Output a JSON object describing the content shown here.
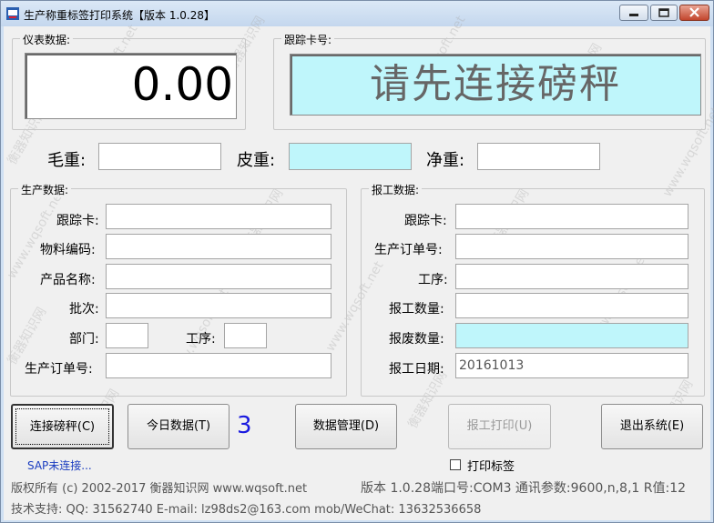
{
  "window": {
    "title": "生产称重标签打印系统【版本 1.0.28】"
  },
  "meter": {
    "group_label": "仪表数据:",
    "value": "0.00"
  },
  "card": {
    "group_label": "跟踪卡号:",
    "message": "请先连接磅秤"
  },
  "weights": {
    "gross_label": "毛重:",
    "tare_label": "皮重:",
    "net_label": "净重:"
  },
  "production": {
    "group_label": "生产数据:",
    "tracking_card_label": "跟踪卡:",
    "material_code_label": "物料编码:",
    "product_name_label": "产品名称:",
    "batch_label": "批次:",
    "department_label": "部门:",
    "process_label": "工序:",
    "order_no_label": "生产订单号:"
  },
  "report": {
    "group_label": "报工数据:",
    "tracking_card_label": "跟踪卡:",
    "order_no_label": "生产订单号:",
    "process_label": "工序:",
    "report_qty_label": "报工数量:",
    "scrap_qty_label": "报废数量:",
    "report_date_label": "报工日期:",
    "report_date_value": "20161013"
  },
  "buttons": {
    "connect": "连接磅秤(C)",
    "today_data": "今日数据(T)",
    "today_count": "3",
    "data_manage": "数据管理(D)",
    "report_print": "报工打印(U)",
    "exit": "退出系统(E)"
  },
  "status": {
    "sap": "SAP未连接...",
    "print_label_checkbox": "打印标签"
  },
  "footer": {
    "copyright": "版权所有 (c) 2002-2017 衡器知识网   www.wqsoft.net",
    "version_info": "版本 1.0.28端口号:COM3 通讯参数:9600,n,8,1 R值:12",
    "support": "技术支持: QQ: 31562740 E-mail: lz98ds2@163.com mob/WeChat: 13632536658"
  },
  "watermark": {
    "cn": "衡器知识网",
    "url": "www.wqsoft.net"
  },
  "colors": {
    "cyan_field": "#bff6fb",
    "count_blue": "#1a1adf",
    "sap_blue": "#1a3cbf"
  }
}
